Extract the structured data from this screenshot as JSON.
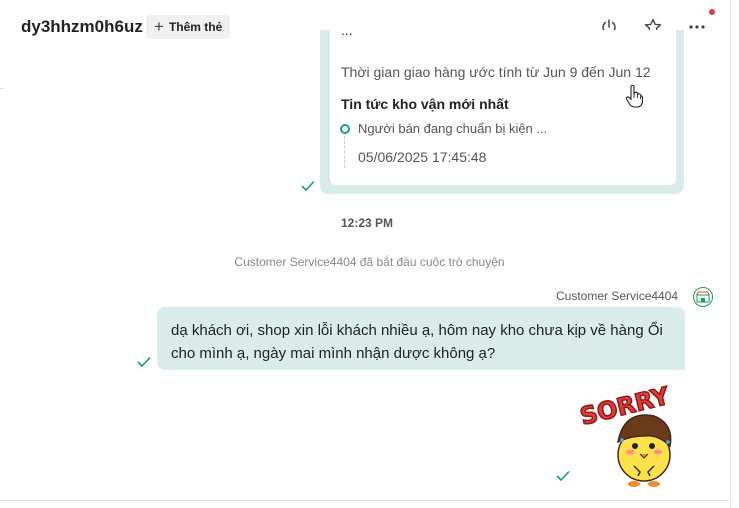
{
  "header": {
    "title": "dy3hhzm0h6uz",
    "add_tag_label": "Thêm thẻ",
    "icons": [
      "power-icon",
      "star-icon",
      "more-icon"
    ]
  },
  "order_card": {
    "partial_text": "...",
    "delivery_estimate": "Thời gian giao hàng ước tính từ Jun  9 đến Jun 12",
    "logistics_title": "Tin tức kho vận mới nhất",
    "logistics_item": "Người bán đang chuẩn bị kiện ...",
    "logistics_time": "05/06/2025 17:45:48"
  },
  "messages": {
    "time": "12:23 PM",
    "system": "Customer Service4404 đã bắt đầu cuộc trò chuyện",
    "agent_name": "Customer Service4404",
    "agent_text": "dạ khách ơi, shop xin lỗi khách nhiều ạ, hôm nay kho chưa kịp về hàng Ổi cho mình ạ, ngày mai mình nhận dược không ạ?",
    "sticker_text": "SORRY"
  },
  "colors": {
    "accent": "#1a9e8b",
    "bubble": "#d9ece9",
    "check": "#1a9e5b",
    "notification": "#e53935"
  }
}
